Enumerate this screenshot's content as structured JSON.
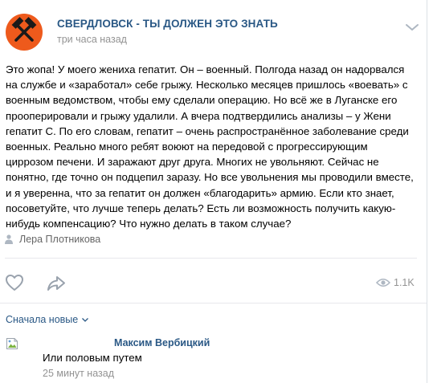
{
  "post": {
    "group_name": "СВЕРДЛОВСК - ТЫ ДОЛЖЕН ЭТО ЗНАТЬ",
    "time": "три часа назад",
    "text_lines": [
      "Это жопа! У моего жениха гепатит. Он – военный. Полгода назад он надорвался",
      "на службе и «заработал» себе грыжу. Несколько месяцев пришлось «воевать» с",
      "военным ведомством, чтобы ему сделали операцию. Но всё же в Луганске его",
      "прооперировали и грыжу удалили. А вчера подтвердились анализы – у Жени",
      "гепатит С. По его словам, гепатит – очень распространённое заболевание среди",
      "военных. Реально много ребят воюют на передовой с прогрессирующим",
      "циррозом печени. И заражают друг друга. Многих не увольняют. Сейчас не",
      "понятно, где точно он подцепил заразу. Но все увольнения мы проводили вместе,",
      "и я уверенна, что за гепатит он должен «благодарить» армию. Если кто знает,",
      "посоветуйте, что лучше теперь делать? Есть ли возможность получить какую-",
      "нибудь компенсацию? Что нужно делать в таком случае?"
    ],
    "signer": "Лера Плотникова",
    "views": "1.1K",
    "colors": {
      "avatar_bg": "#ee5a1c",
      "link": "#2a5885",
      "muted": "#939393"
    }
  },
  "icons": {
    "avatar": "crossed-hammers-icon",
    "more": "chevron-down-icon",
    "signer": "person-icon",
    "like": "heart-icon",
    "share": "share-arrow-icon",
    "views": "eye-icon",
    "sort": "chevron-down-icon"
  },
  "comments": {
    "sort_label": "Сначала новые",
    "items": [
      {
        "author": "Максим Вербицкий",
        "text": "Или половым путем",
        "time": "25 минут назад"
      }
    ]
  }
}
